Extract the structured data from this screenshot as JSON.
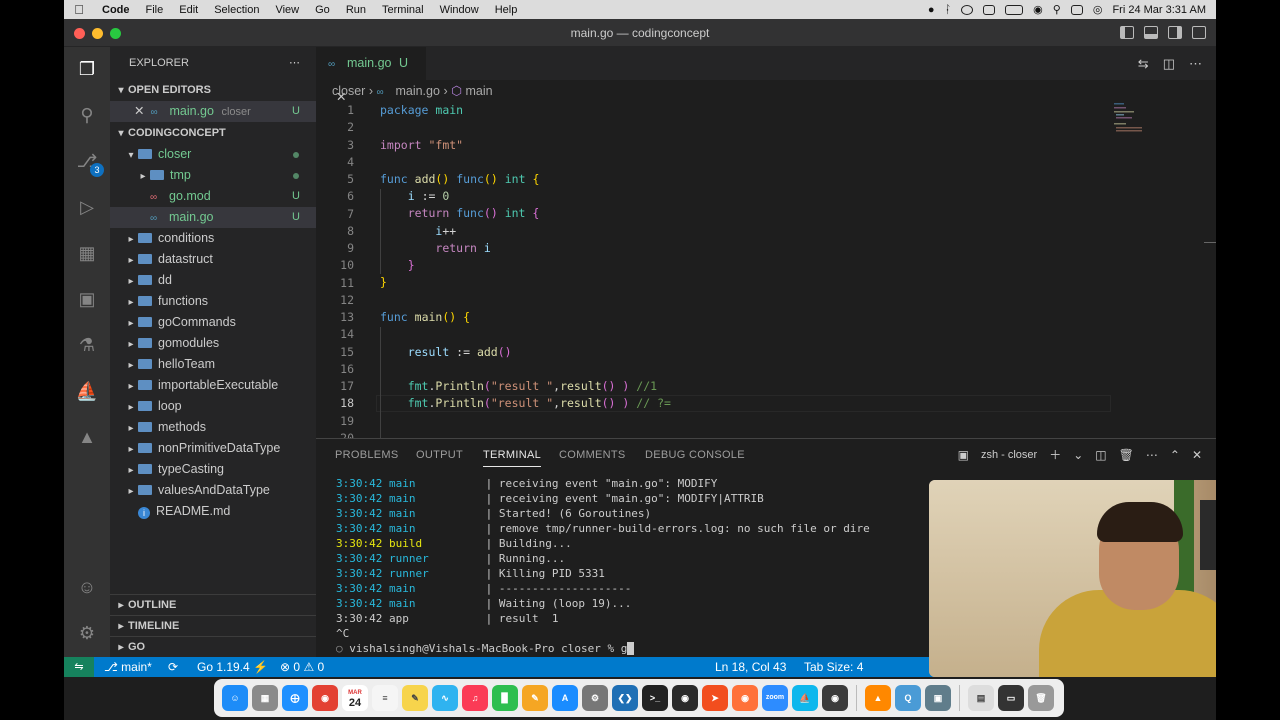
{
  "menubar": {
    "app": "Code",
    "items": [
      "File",
      "Edit",
      "Selection",
      "View",
      "Go",
      "Run",
      "Terminal",
      "Window",
      "Help"
    ],
    "datetime": "Fri 24 Mar  3:31 AM"
  },
  "window": {
    "title": "main.go — codingconcept"
  },
  "activity": {
    "scm_badge": "3"
  },
  "explorer": {
    "title": "EXPLORER",
    "open_editors_header": "OPEN EDITORS",
    "open_editor": {
      "name": "main.go",
      "folder": "closer",
      "status": "U"
    },
    "project_header": "CODINGCONCEPT",
    "tree": [
      {
        "name": "closer",
        "kind": "folder-open",
        "indent": 1,
        "marker": "dot"
      },
      {
        "name": "tmp",
        "kind": "folder",
        "indent": 2,
        "marker": "dot"
      },
      {
        "name": "go.mod",
        "kind": "mod",
        "indent": 2,
        "marker": "U"
      },
      {
        "name": "main.go",
        "kind": "go",
        "indent": 2,
        "marker": "U",
        "selected": true
      },
      {
        "name": "conditions",
        "kind": "folder",
        "indent": 1
      },
      {
        "name": "datastruct",
        "kind": "folder",
        "indent": 1
      },
      {
        "name": "dd",
        "kind": "folder",
        "indent": 1
      },
      {
        "name": "functions",
        "kind": "folder",
        "indent": 1
      },
      {
        "name": "goCommands",
        "kind": "folder",
        "indent": 1
      },
      {
        "name": "gomodules",
        "kind": "folder",
        "indent": 1
      },
      {
        "name": "helloTeam",
        "kind": "folder",
        "indent": 1
      },
      {
        "name": "importableExecutable",
        "kind": "folder",
        "indent": 1
      },
      {
        "name": "loop",
        "kind": "folder",
        "indent": 1
      },
      {
        "name": "methods",
        "kind": "folder",
        "indent": 1
      },
      {
        "name": "nonPrimitiveDataType",
        "kind": "folder",
        "indent": 1
      },
      {
        "name": "typeCasting",
        "kind": "folder",
        "indent": 1
      },
      {
        "name": "valuesAndDataType",
        "kind": "folder",
        "indent": 1
      },
      {
        "name": "README.md",
        "kind": "info",
        "indent": 1
      }
    ],
    "outline": "OUTLINE",
    "timeline": "TIMELINE",
    "go": "GO"
  },
  "editor": {
    "tab_label": "main.go",
    "tab_status": "U",
    "breadcrumb": [
      "closer",
      "main.go",
      "main"
    ],
    "lines": [
      "1",
      "2",
      "3",
      "4",
      "5",
      "6",
      "7",
      "8",
      "9",
      "10",
      "11",
      "12",
      "13",
      "14",
      "15",
      "16",
      "17",
      "18",
      "19",
      "20"
    ],
    "current_line": 18
  },
  "panel": {
    "tabs": [
      "PROBLEMS",
      "OUTPUT",
      "TERMINAL",
      "COMMENTS",
      "DEBUG CONSOLE"
    ],
    "active_tab": "TERMINAL",
    "shell": "zsh - closer",
    "terminal_lines": [
      {
        "time": "3:30:42",
        "src": "main",
        "sep": "|",
        "msg": "receiving event \"main.go\": MODIFY"
      },
      {
        "time": "3:30:42",
        "src": "main",
        "sep": "|",
        "msg": "receiving event \"main.go\": MODIFY|ATTRIB"
      },
      {
        "time": "3:30:42",
        "src": "main",
        "sep": "|",
        "msg": "Started! (6 Goroutines)"
      },
      {
        "time": "3:30:42",
        "src": "main",
        "sep": "|",
        "msg": "remove tmp/runner-build-errors.log: no such file or dire"
      },
      {
        "time": "3:30:42",
        "src": "build",
        "sep": "|",
        "msg": "Building..."
      },
      {
        "time": "3:30:42",
        "src": "runner",
        "sep": "|",
        "msg": "Running..."
      },
      {
        "time": "3:30:42",
        "src": "runner",
        "sep": "|",
        "msg": "Killing PID 5331"
      },
      {
        "time": "3:30:42",
        "src": "main",
        "sep": "|",
        "msg": "--------------------"
      },
      {
        "time": "3:30:42",
        "src": "main",
        "sep": "|",
        "msg": "Waiting (loop 19)..."
      },
      {
        "time": "3:30:42",
        "src": "app",
        "sep": "|",
        "msg": "result  1"
      }
    ],
    "interrupt": "^C",
    "prompt": "vishalsingh@Vishals-MacBook-Pro closer % ",
    "typed": "g"
  },
  "statusbar": {
    "branch": "main*",
    "go_version": "Go 1.19.4",
    "errors": "0",
    "warnings": "0",
    "cursor": "Ln 18, Col 43",
    "tab_size": "Tab Size: 4"
  },
  "dock": {
    "calendar_month": "MAR",
    "calendar_day": "24"
  },
  "colors": {
    "statusbar": "#007acc",
    "remote": "#16825d",
    "untracked": "#73c991"
  }
}
